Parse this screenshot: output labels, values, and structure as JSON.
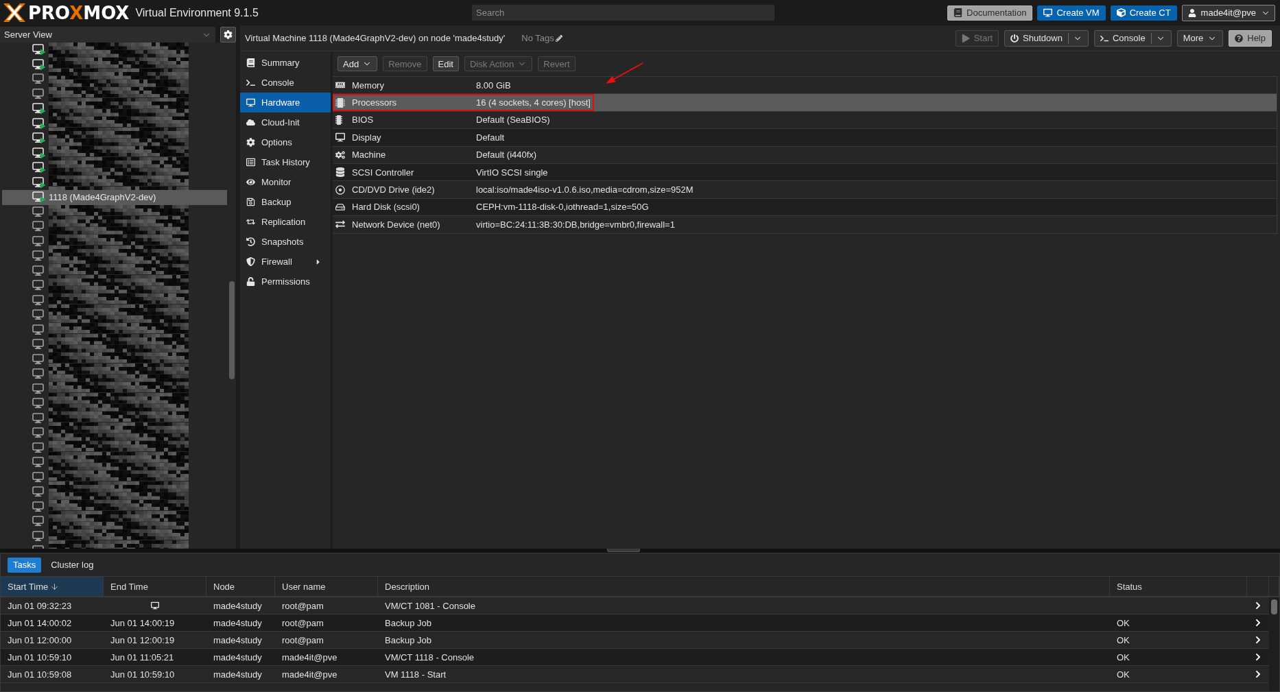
{
  "top_bar": {
    "brand": {
      "parts": [
        {
          "text": "PRO",
          "accent": false
        },
        {
          "text": "X",
          "accent": true
        },
        {
          "text": "MOX",
          "accent": false
        }
      ]
    },
    "version": "Virtual Environment 9.1.5",
    "search": {
      "placeholder": "Search"
    },
    "buttons": [
      {
        "label": "Documentation",
        "kind": "documentation"
      },
      {
        "label": "Create VM",
        "kind": "create-vm"
      },
      {
        "label": "Create CT",
        "kind": "create-ct"
      }
    ],
    "user": {
      "label": "made4it@pve"
    }
  },
  "resource_tree": {
    "view": "Server View",
    "items": [
      {
        "running": true,
        "selected": false
      },
      {
        "running": true,
        "selected": false
      },
      {
        "running": false,
        "selected": false
      },
      {
        "running": false,
        "selected": false
      },
      {
        "running": true,
        "selected": false
      },
      {
        "running": true,
        "selected": false
      },
      {
        "running": true,
        "selected": false
      },
      {
        "running": true,
        "selected": false
      },
      {
        "running": true,
        "selected": false
      },
      {
        "running": true,
        "selected": false
      },
      {
        "label": "1118 (Made4GraphV2-dev)",
        "running": true,
        "selected": true
      },
      {
        "running": false,
        "selected": false
      },
      {
        "running": false,
        "selected": false
      },
      {
        "running": false,
        "selected": false
      },
      {
        "running": false,
        "selected": false
      },
      {
        "running": false,
        "selected": false
      },
      {
        "running": false,
        "selected": false
      },
      {
        "running": false,
        "selected": false
      },
      {
        "running": false,
        "selected": false
      },
      {
        "running": false,
        "selected": false
      },
      {
        "running": false,
        "selected": false
      },
      {
        "running": false,
        "selected": false
      },
      {
        "running": false,
        "selected": false
      },
      {
        "running": false,
        "selected": false
      },
      {
        "running": false,
        "selected": false
      },
      {
        "running": false,
        "selected": false
      },
      {
        "running": false,
        "selected": false
      },
      {
        "running": false,
        "selected": false
      },
      {
        "running": false,
        "selected": false
      },
      {
        "running": false,
        "selected": false
      },
      {
        "running": false,
        "selected": false
      },
      {
        "running": false,
        "selected": false
      },
      {
        "running": false,
        "selected": false
      },
      {
        "running": false,
        "selected": false
      },
      {
        "running": false,
        "selected": false
      }
    ]
  },
  "vm_header": {
    "title": "Virtual Machine 1118 (Made4GraphV2-dev) on node 'made4study'",
    "tags": "No Tags",
    "actions": [
      {
        "label": "Start",
        "kind": "start",
        "disabled": true,
        "dropdown": false,
        "split": false
      },
      {
        "label": "Shutdown",
        "kind": "shutdown",
        "disabled": false,
        "dropdown": true,
        "split": true
      },
      {
        "label": "Console",
        "kind": "console",
        "disabled": false,
        "dropdown": true,
        "split": true
      },
      {
        "label": "More",
        "kind": "more",
        "disabled": false,
        "dropdown": true,
        "split": false
      },
      {
        "label": "Help",
        "kind": "help",
        "disabled": false,
        "dropdown": false,
        "split": false
      }
    ]
  },
  "nav": [
    {
      "label": "Summary",
      "kind": "summary",
      "selected": false,
      "submenu": false
    },
    {
      "label": "Console",
      "kind": "console",
      "selected": false,
      "submenu": false
    },
    {
      "label": "Hardware",
      "kind": "hardware",
      "selected": true,
      "submenu": false
    },
    {
      "label": "Cloud-Init",
      "kind": "cloud-init",
      "selected": false,
      "submenu": false
    },
    {
      "label": "Options",
      "kind": "options",
      "selected": false,
      "submenu": false
    },
    {
      "label": "Task History",
      "kind": "task-history",
      "selected": false,
      "submenu": false
    },
    {
      "label": "Monitor",
      "kind": "monitor",
      "selected": false,
      "submenu": false
    },
    {
      "label": "Backup",
      "kind": "backup",
      "selected": false,
      "submenu": false
    },
    {
      "label": "Replication",
      "kind": "replication",
      "selected": false,
      "submenu": false
    },
    {
      "label": "Snapshots",
      "kind": "snapshots",
      "selected": false,
      "submenu": false
    },
    {
      "label": "Firewall",
      "kind": "firewall",
      "selected": false,
      "submenu": true
    },
    {
      "label": "Permissions",
      "kind": "permissions",
      "selected": false,
      "submenu": false
    }
  ],
  "hardware": {
    "toolbar": [
      {
        "label": "Add",
        "disabled": false,
        "dropdown": true
      },
      {
        "label": "Remove",
        "disabled": true,
        "dropdown": false
      },
      {
        "label": "Edit",
        "disabled": false,
        "dropdown": false
      },
      {
        "label": "Disk Action",
        "disabled": true,
        "dropdown": true
      },
      {
        "label": "Revert",
        "disabled": true,
        "dropdown": false
      }
    ],
    "rows": [
      {
        "kind": "memory",
        "name": "Memory",
        "value": "8.00 GiB",
        "selected": false,
        "highlighted": false
      },
      {
        "kind": "processors",
        "name": "Processors",
        "value": "16 (4 sockets, 4 cores) [host]",
        "selected": true,
        "highlighted": true
      },
      {
        "kind": "bios",
        "name": "BIOS",
        "value": "Default (SeaBIOS)",
        "selected": false,
        "highlighted": false
      },
      {
        "kind": "display",
        "name": "Display",
        "value": "Default",
        "selected": false,
        "highlighted": false
      },
      {
        "kind": "machine",
        "name": "Machine",
        "value": "Default (i440fx)",
        "selected": false,
        "highlighted": false
      },
      {
        "kind": "scsi",
        "name": "SCSI Controller",
        "value": "VirtIO SCSI single",
        "selected": false,
        "highlighted": false
      },
      {
        "kind": "cdrom",
        "name": "CD/DVD Drive (ide2)",
        "value": "local:iso/made4iso-v1.0.6.iso,media=cdrom,size=952M",
        "selected": false,
        "highlighted": false
      },
      {
        "kind": "disk",
        "name": "Hard Disk (scsi0)",
        "value": "CEPH:vm-1118-disk-0,iothread=1,size=50G",
        "selected": false,
        "highlighted": false
      },
      {
        "kind": "network",
        "name": "Network Device (net0)",
        "value": "virtio=BC:24:11:3B:30:DB,bridge=vmbr0,firewall=1",
        "selected": false,
        "highlighted": false
      }
    ]
  },
  "tasks_panel": {
    "tabs": [
      {
        "label": "Tasks",
        "selected": true
      },
      {
        "label": "Cluster log",
        "selected": false
      }
    ],
    "columns": [
      {
        "label": "Start Time",
        "sorted": true
      },
      {
        "label": "End Time",
        "sorted": false
      },
      {
        "label": "Node",
        "sorted": false
      },
      {
        "label": "User name",
        "sorted": false
      },
      {
        "label": "Description",
        "sorted": false
      },
      {
        "label": "Status",
        "sorted": false
      }
    ],
    "rows": [
      {
        "start_time": "Jun 01 09:32:23",
        "running": true,
        "node": "made4study",
        "user": "root@pam",
        "description": "VM/CT 1081 - Console"
      },
      {
        "start_time": "Jun 01 14:00:02",
        "end_time": "Jun 01 14:00:19",
        "running": false,
        "node": "made4study",
        "user": "root@pam",
        "description": "Backup Job",
        "status": "OK"
      },
      {
        "start_time": "Jun 01 12:00:00",
        "end_time": "Jun 01 12:00:19",
        "running": false,
        "node": "made4study",
        "user": "root@pam",
        "description": "Backup Job",
        "status": "OK"
      },
      {
        "start_time": "Jun 01 10:59:10",
        "end_time": "Jun 01 11:05:21",
        "running": false,
        "node": "made4study",
        "user": "made4it@pve",
        "description": "VM/CT 1118 - Console",
        "status": "OK"
      },
      {
        "start_time": "Jun 01 10:59:08",
        "end_time": "Jun 01 10:59:10",
        "running": false,
        "node": "made4study",
        "user": "made4it@pve",
        "description": "VM 1118 - Start",
        "status": "OK"
      }
    ]
  }
}
